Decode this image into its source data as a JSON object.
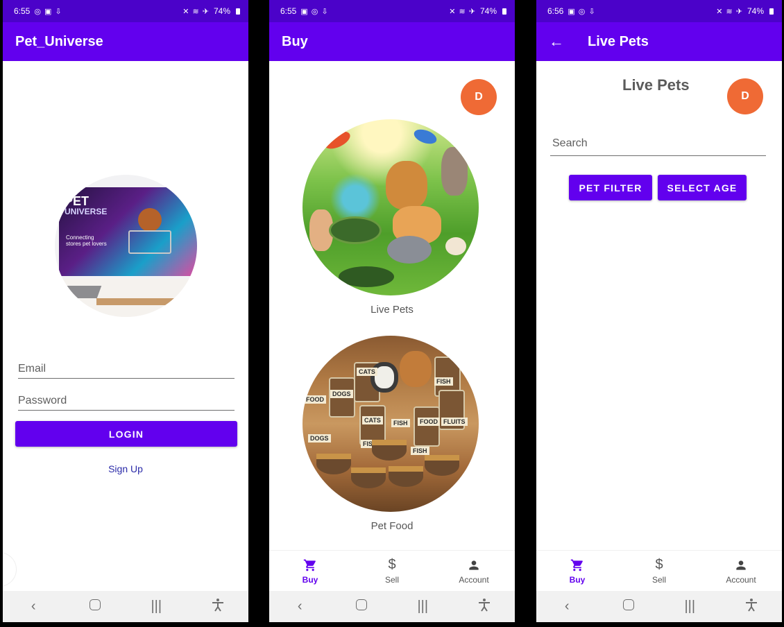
{
  "screens": [
    {
      "status": {
        "time": "6:55",
        "left_icons": "◎ ▣ ⇩",
        "right_icons": "✕ ≋ ✈",
        "battery": "74%"
      },
      "appbar": {
        "title": "Pet_Universe"
      },
      "logo": {
        "title_line1": "PET",
        "title_line2": "UNIVERSE",
        "tagline": "Connecting stores pet lovers"
      },
      "email": {
        "placeholder": "Email"
      },
      "password": {
        "placeholder": "Password"
      },
      "login_label": "LOGIN",
      "signup_label": "Sign Up"
    },
    {
      "status": {
        "time": "6:55",
        "left_icons": "▣ ◎ ⇩",
        "right_icons": "✕ ≋ ✈",
        "battery": "74%"
      },
      "appbar": {
        "title": "Buy"
      },
      "avatar": "D",
      "categories": [
        {
          "label": "Live Pets"
        },
        {
          "label": "Pet Food",
          "jar_labels": [
            "DOGS",
            "CATS",
            "FISH",
            "FOOD",
            "FLUITS",
            "CATS",
            "FISH",
            "DOGS",
            "FISH",
            "FISH",
            "FOOD"
          ]
        }
      ]
    },
    {
      "status": {
        "time": "6:56",
        "left_icons": "▣ ◎ ⇩",
        "right_icons": "✕ ≋ ✈",
        "battery": "74%"
      },
      "appbar": {
        "title": "Live Pets"
      },
      "page_title": "Live Pets",
      "avatar": "D",
      "search": {
        "placeholder": "Search"
      },
      "buttons": {
        "pet_filter": "PET FILTER",
        "select_age": "SELECT AGE"
      }
    }
  ],
  "bottom_nav": {
    "items": [
      {
        "label": "Buy",
        "icon": "cart-icon"
      },
      {
        "label": "Sell",
        "icon": "dollar-icon"
      },
      {
        "label": "Account",
        "icon": "person-icon"
      }
    ],
    "active": "Buy"
  },
  "system_nav": {
    "back": "‹",
    "recents": "|||",
    "accessibility": "accessibility-icon"
  },
  "colors": {
    "status_bar": "#4b02c9",
    "app_bar": "#6200ee",
    "primary": "#6200ee",
    "avatar": "#ef6a35"
  }
}
